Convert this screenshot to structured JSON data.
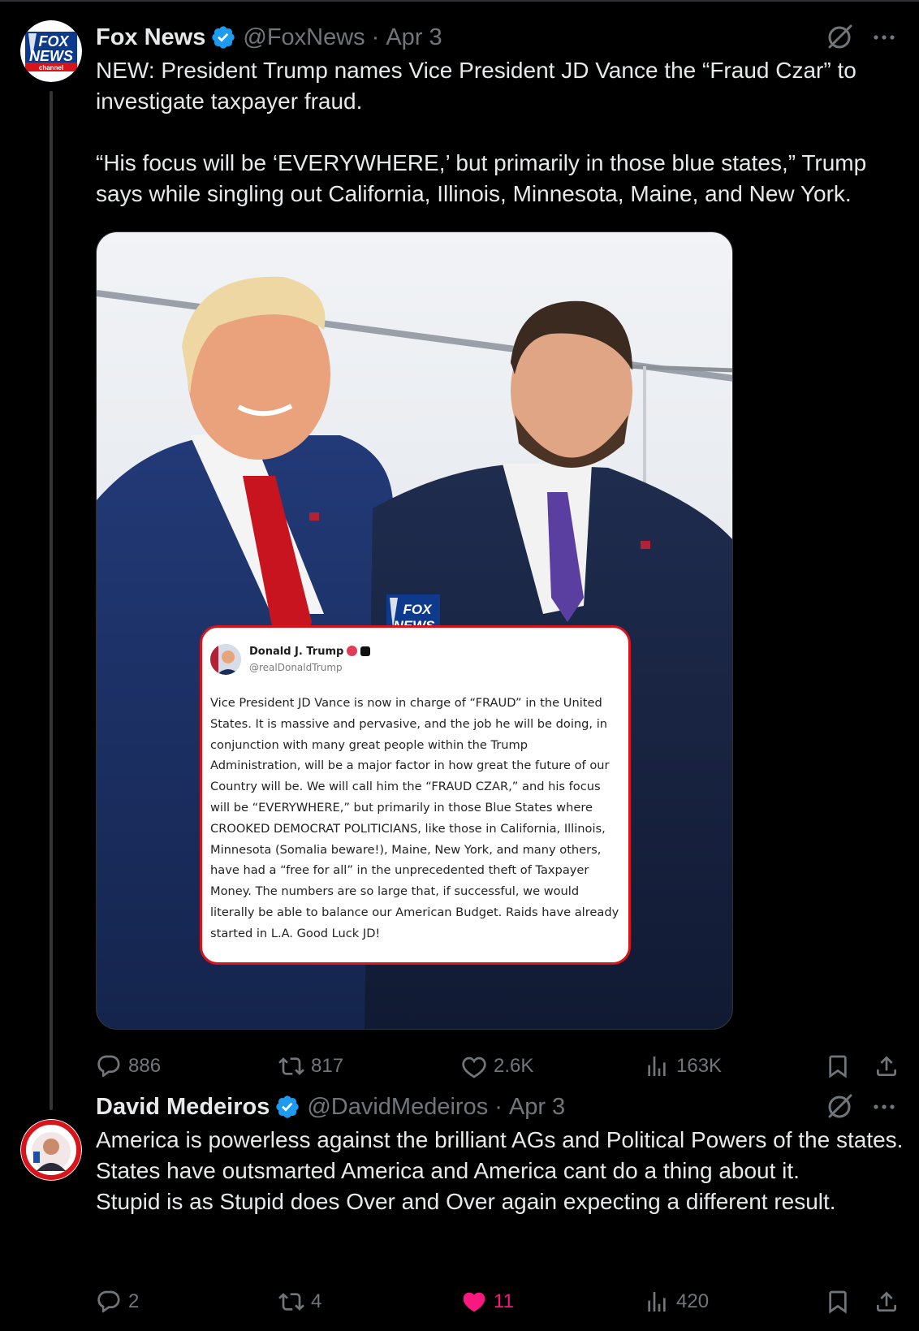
{
  "tweets": [
    {
      "author_name": "Fox News",
      "handle": "@FoxNews",
      "separator": "·",
      "date": "Apr 3",
      "verified": true,
      "avatar": "fox-news-channel-logo",
      "text": "NEW: President Trump names Vice President JD Vance the “Fraud Czar” to investigate taxpayer fraud.\n\n“His focus will be ‘EVERYWHERE,’ but primarily in those blue states,” Trump says while singling out California, Illinois, Minnesota, Maine, and New York.",
      "media": {
        "overlay_logo": "FOX NEWS channel",
        "embedded_post": {
          "author_name": "Donald J. Trump",
          "handle": "@realDonaldTrump",
          "text": "Vice President JD Vance is now in charge of “FRAUD” in the United States. It is massive and pervasive, and the job he will be doing, in conjunction with many great people within the Trump Administration, will be a major factor in how great the future of our Country will be. We will call him the “FRAUD CZAR,” and his focus will be “EVERYWHERE,” but primarily in those Blue States where CROOKED DEMOCRAT POLITICIANS, like those in California, Illinois, Minnesota (Somalia beware!), Maine, New York, and many others, have had a “free for all” in the unprecedented theft of Taxpayer Money. The numbers are so large that, if successful, we would literally be able to balance our American Budget. Raids have already started in L.A. Good Luck JD!"
        }
      },
      "stats": {
        "replies": "886",
        "reposts": "817",
        "likes": "2.6K",
        "views": "163K"
      },
      "liked": false
    },
    {
      "author_name": "David Medeiros",
      "handle": "@DavidMedeiros",
      "separator": "·",
      "date": "Apr 3",
      "verified": true,
      "avatar": "user-avatar",
      "text": "America is powerless against the brilliant AGs and Political Powers of the states.\nStates have outsmarted America and America cant do a thing about it.\nStupid is as Stupid does Over and Over again expecting a different result.",
      "stats": {
        "replies": "2",
        "reposts": "4",
        "likes": "11",
        "views": "420"
      },
      "liked": true
    }
  ],
  "colors": {
    "background": "#000000",
    "text_primary": "#e7e9ea",
    "text_secondary": "#71767b",
    "verified_blue": "#1d9bf0",
    "like_pink": "#f91880",
    "fox_red": "#d8141b"
  }
}
